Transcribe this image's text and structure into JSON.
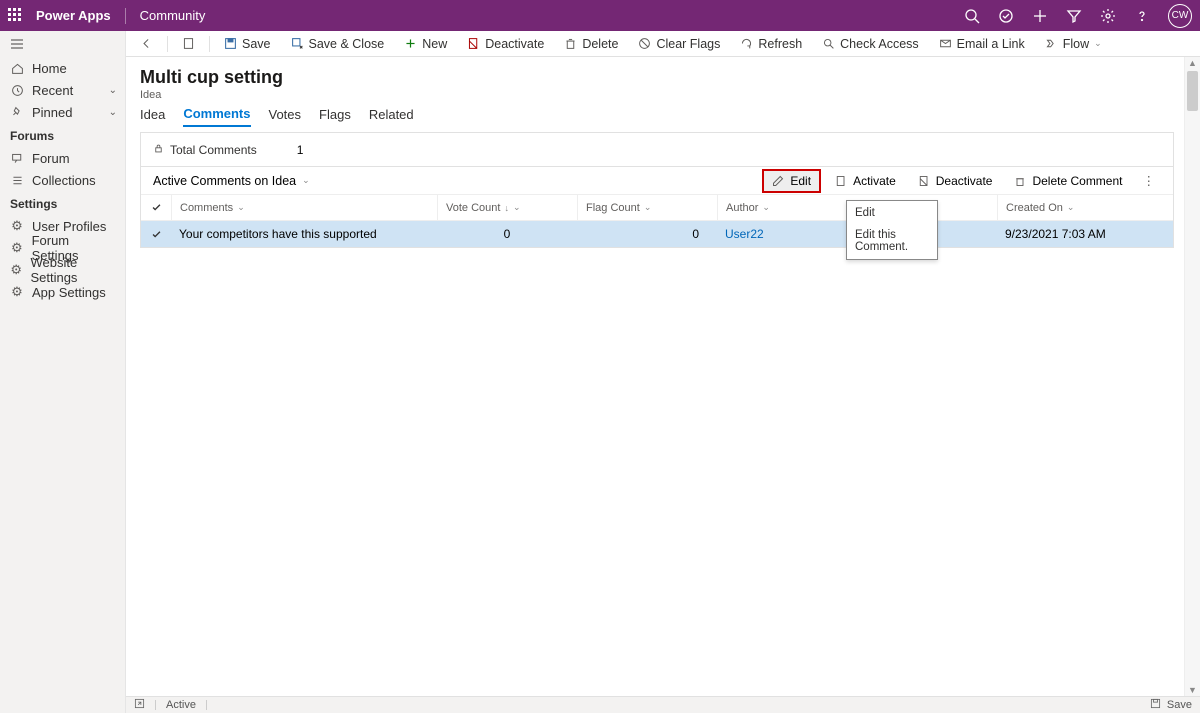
{
  "topbar": {
    "brand": "Power Apps",
    "context": "Community",
    "avatar": "CW"
  },
  "leftnav": {
    "home": "Home",
    "recent": "Recent",
    "pinned": "Pinned",
    "group_forums": "Forums",
    "forum": "Forum",
    "collections": "Collections",
    "group_settings": "Settings",
    "user_profiles": "User Profiles",
    "forum_settings": "Forum Settings",
    "website_settings": "Website Settings",
    "app_settings": "App Settings"
  },
  "cmdbar": {
    "save": "Save",
    "save_close": "Save & Close",
    "new": "New",
    "deactivate": "Deactivate",
    "delete": "Delete",
    "clear_flags": "Clear Flags",
    "refresh": "Refresh",
    "check_access": "Check Access",
    "email_link": "Email a Link",
    "flow": "Flow"
  },
  "page": {
    "title": "Multi cup setting",
    "subtitle": "Idea"
  },
  "tabs": {
    "idea": "Idea",
    "comments": "Comments",
    "votes": "Votes",
    "flags": "Flags",
    "related": "Related"
  },
  "panel": {
    "total_label": "Total Comments",
    "total_value": "1",
    "view_name": "Active Comments on Idea",
    "actions": {
      "edit": "Edit",
      "activate": "Activate",
      "deactivate": "Deactivate",
      "delete_comment": "Delete Comment"
    }
  },
  "grid": {
    "headers": {
      "comments": "Comments",
      "vote": "Vote Count",
      "flag": "Flag Count",
      "author": "Author",
      "created": "Created On"
    },
    "rows": [
      {
        "comment": "Your competitors have this supported",
        "vote": "0",
        "flag": "0",
        "author": "User22",
        "created": "9/23/2021 7:03 AM"
      }
    ]
  },
  "tooltip": {
    "title": "Edit",
    "desc": "Edit this Comment."
  },
  "statusbar": {
    "state": "Active",
    "save": "Save"
  }
}
